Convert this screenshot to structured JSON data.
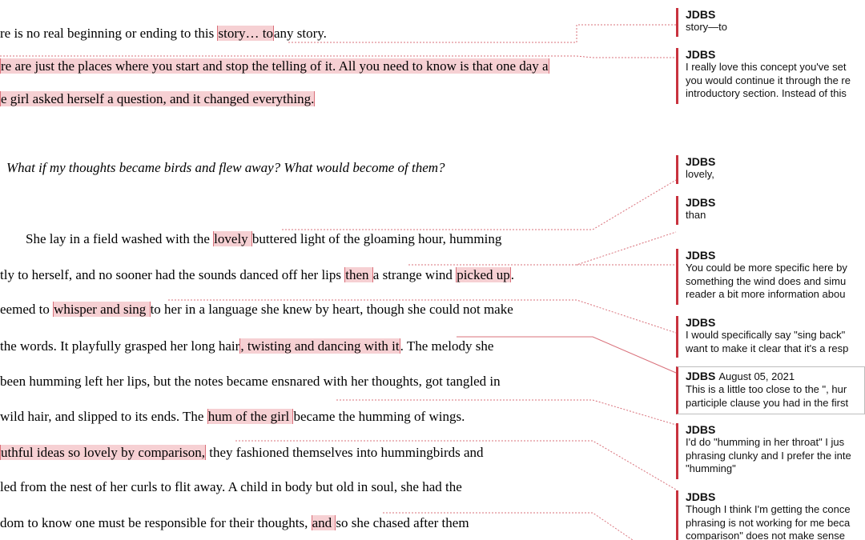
{
  "document": {
    "lines": [
      {
        "segments": [
          {
            "t": "re is no real beginning or ending to this "
          },
          {
            "t": "story… to",
            "h": true
          },
          {
            "t": "any story."
          }
        ]
      },
      {
        "segments": [
          {
            "t": "re are just the places where you start and stop the telling of it.  All you need to know is that one day a ",
            "h": true
          }
        ]
      },
      {
        "segments": [
          {
            "t": "e girl asked herself a question, and it changed everything.",
            "h": true
          }
        ]
      },
      {
        "segments": [
          {
            "t": "What if my thoughts became birds and flew away? What would become of them?"
          }
        ]
      },
      {
        "segments": [
          {
            "t": "She lay in a field washed with the "
          },
          {
            "t": "lovely ",
            "h": true
          },
          {
            "t": "buttered light of the gloaming hour, humming"
          }
        ]
      },
      {
        "segments": [
          {
            "t": "tly to herself, and no sooner had the sounds danced off her lips "
          },
          {
            "t": "then ",
            "h": true
          },
          {
            "t": "a strange wind "
          },
          {
            "t": "picked up",
            "h": true
          },
          {
            "t": "."
          }
        ]
      },
      {
        "segments": [
          {
            "t": "eemed to "
          },
          {
            "t": "whisper and sing ",
            "h": true
          },
          {
            "t": "to her in a language she knew by heart, though she could not make"
          }
        ]
      },
      {
        "segments": [
          {
            "t": " the words. It playfully grasped her long hair"
          },
          {
            "t": ", twisting and dancing with it",
            "h": true
          },
          {
            "t": ". The melody she"
          }
        ]
      },
      {
        "segments": [
          {
            "t": " been humming left her lips, but the notes became ensnared with her thoughts, got tangled in"
          }
        ]
      },
      {
        "segments": [
          {
            "t": " wild hair, and slipped to its ends. The "
          },
          {
            "t": "hum of the girl ",
            "h": true
          },
          {
            "t": "became the humming of wings."
          }
        ]
      },
      {
        "segments": [
          {
            "t": "uthful ideas so lovely by comparison,",
            "h": true
          },
          {
            "t": " they fashioned themselves into hummingbirds and"
          }
        ]
      },
      {
        "segments": [
          {
            "t": "led from the nest of her curls to flit away.  A child in body but old in soul, she had the"
          }
        ]
      },
      {
        "segments": [
          {
            "t": "dom to know one must be responsible for their thoughts, "
          },
          {
            "t": "and ",
            "h": true
          },
          {
            "t": "so she chased after them"
          }
        ]
      }
    ]
  },
  "comments": [
    {
      "author": "JDBS",
      "date": "",
      "lines": [
        "story—to"
      ]
    },
    {
      "author": "JDBS",
      "date": "",
      "lines": [
        "I really love this concept you've set",
        "you would continue it through the re",
        "introductory section.  Instead of this"
      ]
    },
    {
      "author": "JDBS",
      "date": "",
      "lines": [
        "lovely,"
      ]
    },
    {
      "author": "JDBS",
      "date": "",
      "lines": [
        "than"
      ]
    },
    {
      "author": "JDBS",
      "date": "",
      "lines": [
        "You could be more specific here by",
        "something the wind does and simu",
        "reader a bit more information abou"
      ]
    },
    {
      "author": "JDBS",
      "date": "",
      "lines": [
        "I would specifically say \"sing back\"",
        "want to make it clear that it's a resp"
      ]
    },
    {
      "author": "JDBS",
      "date": "August 05, 2021",
      "lines": [
        "This is a little too close to the \", hur",
        "participle clause you had in the first"
      ]
    },
    {
      "author": "JDBS",
      "date": "",
      "lines": [
        "I'd do \"humming in her throat\"  I jus",
        "phrasing clunky and I prefer the inte",
        "\"humming\""
      ]
    },
    {
      "author": "JDBS",
      "date": "",
      "lines": [
        "Though I think I'm getting the conce",
        "phrasing is not working for me beca",
        "comparison\" does not make sense"
      ]
    }
  ],
  "colors": {
    "highlight": "#f6d0d3",
    "accent": "#c8323e",
    "connector": "#d9707a"
  }
}
